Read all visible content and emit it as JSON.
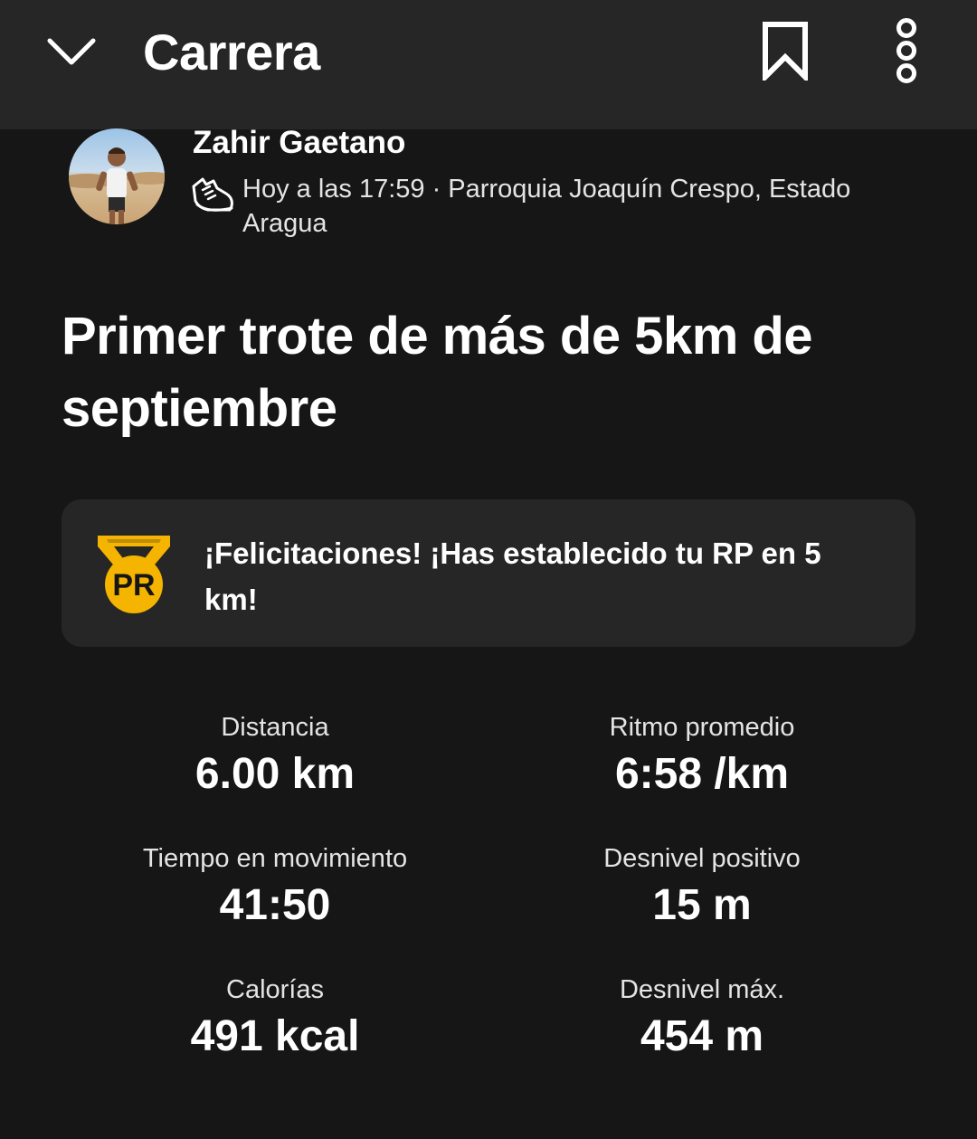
{
  "header": {
    "title": "Carrera",
    "back_icon": "chevron-down-icon",
    "bookmark_icon": "bookmark-icon",
    "more_icon": "more-vertical-icon"
  },
  "athlete": {
    "name": "Zahir Gaetano",
    "activity_icon": "running-shoe-icon",
    "meta": "Hoy a las 17:59 · Parroquia Joaquín Crespo, Estado Aragua"
  },
  "activity": {
    "title": "Primer trote de más de 5km de septiembre"
  },
  "pr_banner": {
    "icon": "pr-medal-icon",
    "medal_label": "PR",
    "text": "¡Felicitaciones! ¡Has establecido tu RP en 5 km!",
    "accent_color": "#f5b400"
  },
  "stats": [
    {
      "label": "Distancia",
      "value": "6.00 km"
    },
    {
      "label": "Ritmo promedio",
      "value": "6:58 /km"
    },
    {
      "label": "Tiempo en movimiento",
      "value": "41:50"
    },
    {
      "label": "Desnivel positivo",
      "value": "15 m"
    },
    {
      "label": "Calorías",
      "value": "491 kcal"
    },
    {
      "label": "Desnivel máx.",
      "value": "454 m"
    }
  ],
  "colors": {
    "background": "#161616",
    "surface": "#262626",
    "text": "#ffffff",
    "secondary_text": "#e4e4e4"
  }
}
